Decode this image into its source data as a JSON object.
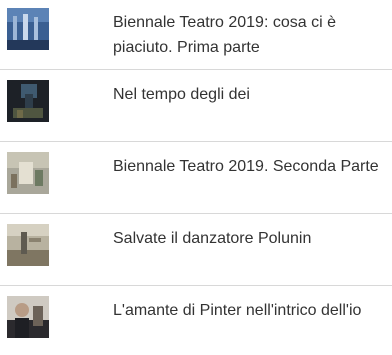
{
  "articles": [
    {
      "title": "Biennale Teatro 2019: cosa ci è piaciuto. Prima parte",
      "thumbnail": "thumb-stage-blue"
    },
    {
      "title": "Nel tempo degli dei",
      "thumbnail": "thumb-dark-scene"
    },
    {
      "title": "Biennale Teatro 2019. Seconda Parte",
      "thumbnail": "thumb-light-scene"
    },
    {
      "title": "Salvate il danzatore Polunin",
      "thumbnail": "thumb-dancer"
    },
    {
      "title": "L'amante di Pinter nell'intrico dell'io",
      "thumbnail": "thumb-portrait"
    }
  ]
}
